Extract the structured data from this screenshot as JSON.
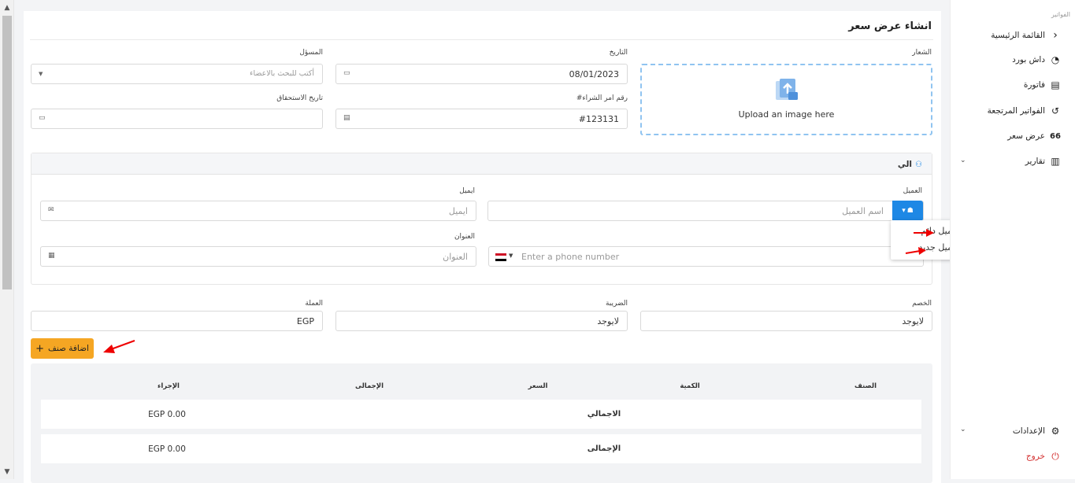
{
  "page": {
    "title": "انشاء عرض سعر"
  },
  "form": {
    "logo_label": "الشعار",
    "upload_text": "Upload an image here",
    "date_label": "التاريخ",
    "date_value": "08/01/2023",
    "responsible_label": "المسؤل",
    "responsible_placeholder": "أكتب للبحث بالاعضاء",
    "po_label": "رقم امر الشراء#",
    "po_value": "#123131",
    "due_label": "تاريخ الاستحقاق",
    "due_value": ""
  },
  "to": {
    "title": "الي",
    "client_label": "العميل",
    "client_placeholder": "اسم العميل",
    "email_label": "ايميل",
    "email_placeholder": "ايميل",
    "phone_placeholder": "Enter a phone number",
    "address_label": "العنوان",
    "address_placeholder": "العنوان",
    "dropdown": [
      "عميل دائم",
      "عميل جديد"
    ]
  },
  "settings": {
    "discount_label": "الخصم",
    "discount_value": "لايوجد",
    "tax_label": "الضريبة",
    "tax_value": "لايوجد",
    "currency_label": "العملة",
    "currency_value": "EGP"
  },
  "add_item_button": "اضافة صنف",
  "table": {
    "headers": [
      "الصنف",
      "الكمية",
      "السعر",
      "الإجمالى",
      "الإجراء"
    ],
    "rows": [
      {
        "label": "الاجمالي",
        "amount": "EGP 0.00"
      },
      {
        "label": "الإجمالى",
        "amount": "EGP 0.00"
      }
    ]
  },
  "sidebar": {
    "section": "الفواتير",
    "items": [
      {
        "label": "القائمة الرئيسية",
        "icon": "chevron-left-icon"
      },
      {
        "label": "داش بورد",
        "icon": "dashboard-icon"
      },
      {
        "label": "فاتورة",
        "icon": "invoice-icon"
      },
      {
        "label": "الفواتير المرتجعة",
        "icon": "return-icon"
      },
      {
        "label": "عرض سعر",
        "icon": "quote-icon"
      },
      {
        "label": "تقارير",
        "icon": "chart-icon"
      }
    ],
    "settings_label": "الإعدادات",
    "logout_label": "خروج"
  },
  "colors": {
    "accent": "#f5a623",
    "primary": "#1e88e5",
    "danger": "#d32f2f"
  }
}
